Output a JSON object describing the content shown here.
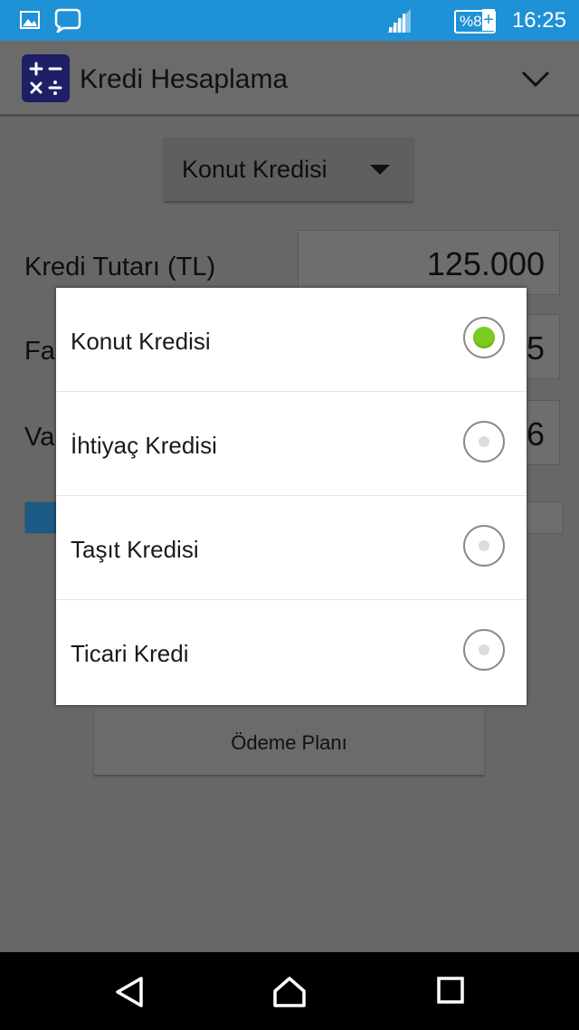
{
  "status_bar": {
    "time": "16:25",
    "battery": "%81",
    "charging": "+",
    "icons": [
      "image-icon",
      "chat-bubble-icon",
      "signal-icon"
    ]
  },
  "action_bar": {
    "title": "Kredi Hesaplama",
    "icon": "calculator-icon",
    "menu_icon": "chevron-down-icon"
  },
  "form": {
    "loan_type": "Konut Kredisi",
    "amount_label": "Kredi Tutarı (TL)",
    "amount_value": "125.000",
    "rate_label_visible": "Fa",
    "rate_value_visible": "5",
    "term_label_visible": "Va",
    "term_value_visible": "6",
    "progress_fraction": 0.06,
    "plan_button": "Ödeme Planı"
  },
  "dialog": {
    "options": [
      {
        "label": "Konut Kredisi",
        "selected": true
      },
      {
        "label": "İhtiyaç Kredisi",
        "selected": false
      },
      {
        "label": "Taşıt Kredisi",
        "selected": false
      },
      {
        "label": "Ticari Kredi",
        "selected": false
      }
    ]
  },
  "nav_bar": {
    "icons": [
      "back-icon",
      "home-icon",
      "recents-icon"
    ]
  },
  "colors": {
    "status_bar": "#1f91d6",
    "dim_background": "#676767",
    "radio_selected": "#7ecb20"
  }
}
